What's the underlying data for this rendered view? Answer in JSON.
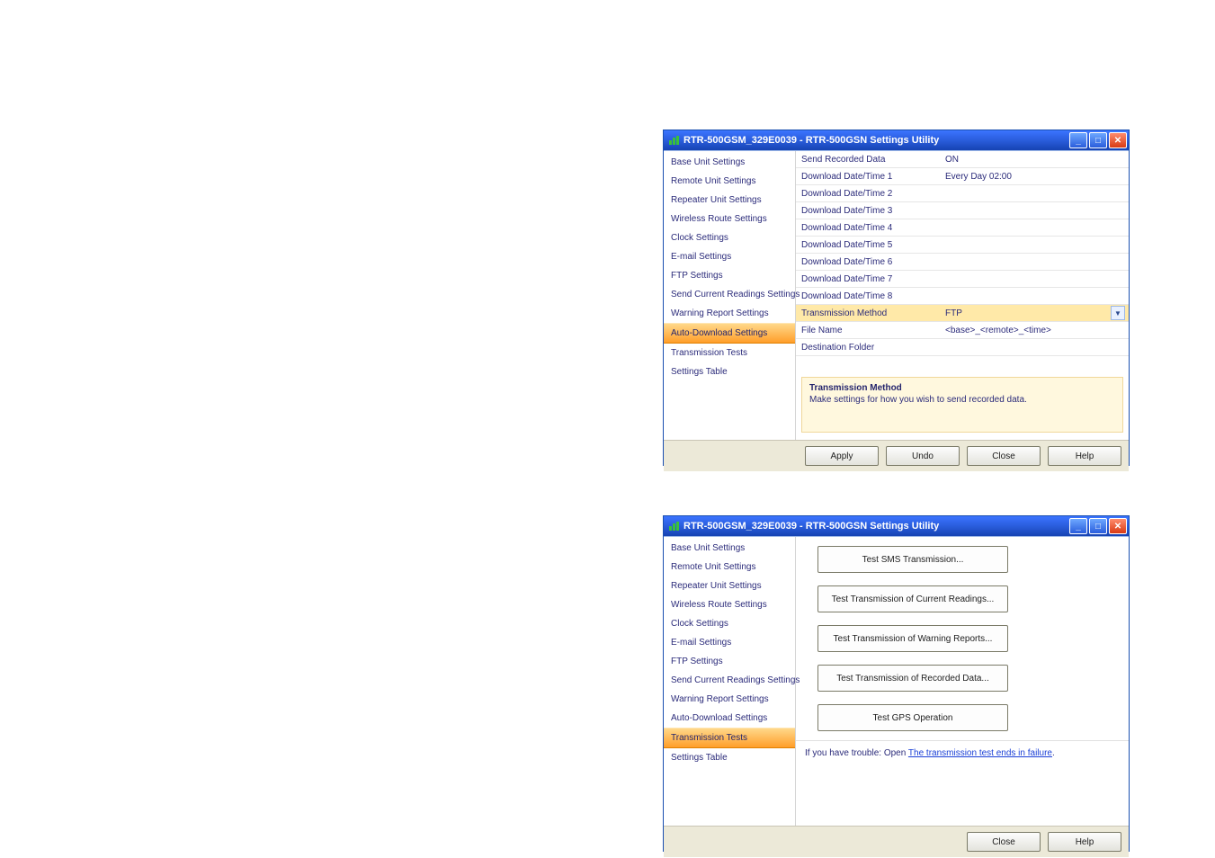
{
  "window1": {
    "title": "RTR-500GSM_329E0039 - RTR-500GSN Settings Utility",
    "sidebar": [
      "Base Unit Settings",
      "Remote Unit Settings",
      "Repeater Unit Settings",
      "Wireless Route Settings",
      "Clock Settings",
      "E-mail Settings",
      "FTP Settings",
      "Send Current Readings Settings",
      "Warning Report Settings",
      "Auto-Download Settings",
      "Transmission  Tests",
      "Settings Table"
    ],
    "sidebar_active_index": 9,
    "rows": [
      {
        "label": "Send Recorded Data",
        "value": "ON",
        "highlight": false
      },
      {
        "label": "Download Date/Time 1",
        "value": "Every Day  02:00",
        "highlight": false
      },
      {
        "label": "Download Date/Time 2",
        "value": "",
        "highlight": false
      },
      {
        "label": "Download Date/Time 3",
        "value": "",
        "highlight": false
      },
      {
        "label": "Download Date/Time 4",
        "value": "",
        "highlight": false
      },
      {
        "label": "Download Date/Time 5",
        "value": "",
        "highlight": false
      },
      {
        "label": "Download Date/Time 6",
        "value": "",
        "highlight": false
      },
      {
        "label": "Download Date/Time 7",
        "value": "",
        "highlight": false
      },
      {
        "label": "Download Date/Time 8",
        "value": "",
        "highlight": false
      },
      {
        "label": "Transmission Method",
        "value": "FTP",
        "highlight": true,
        "dropdown": true
      },
      {
        "label": "File Name",
        "value": "<base>_<remote>_<time>",
        "highlight": false
      },
      {
        "label": "Destination Folder",
        "value": "",
        "highlight": false
      }
    ],
    "hint_title": "Transmission Method",
    "hint_text": "Make settings for how you wish to send recorded data.",
    "buttons": [
      "Apply",
      "Undo",
      "Close",
      "Help"
    ]
  },
  "window2": {
    "title": "RTR-500GSM_329E0039 - RTR-500GSN Settings Utility",
    "sidebar": [
      "Base Unit Settings",
      "Remote Unit Settings",
      "Repeater Unit Settings",
      "Wireless Route Settings",
      "Clock Settings",
      "E-mail Settings",
      "FTP Settings",
      "Send Current Readings Settings",
      "Warning Report Settings",
      "Auto-Download Settings",
      "Transmission  Tests",
      "Settings Table"
    ],
    "sidebar_active_index": 10,
    "test_buttons": [
      "Test SMS Transmission...",
      "Test Transmission of Current Readings...",
      "Test Transmission of Warning Reports...",
      "Test Transmission of Recorded Data...",
      "Test GPS Operation"
    ],
    "trouble_prefix": "If you have trouble: Open",
    "trouble_link": "The transmission test ends in failure",
    "trouble_suffix": ".",
    "buttons": [
      "Close",
      "Help"
    ]
  }
}
